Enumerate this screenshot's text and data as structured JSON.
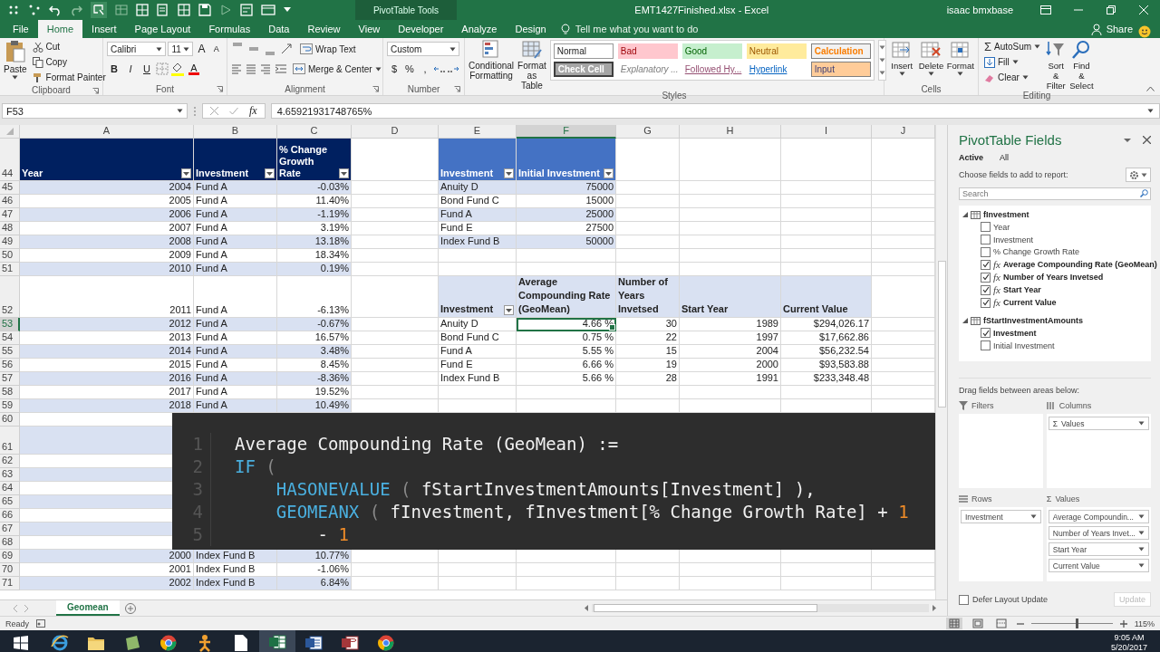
{
  "title_bar": {
    "context_tab_group": "PivotTable Tools",
    "title": "EMT1427Finished.xlsx  -  Excel",
    "user": "isaac bmxbase"
  },
  "ribbon_tabs": [
    {
      "label": "File",
      "selected": false
    },
    {
      "label": "Home",
      "selected": true
    },
    {
      "label": "Insert",
      "selected": false
    },
    {
      "label": "Page Layout",
      "selected": false
    },
    {
      "label": "Formulas",
      "selected": false
    },
    {
      "label": "Data",
      "selected": false
    },
    {
      "label": "Review",
      "selected": false
    },
    {
      "label": "View",
      "selected": false
    },
    {
      "label": "Developer",
      "selected": false
    },
    {
      "label": "Analyze",
      "selected": false
    },
    {
      "label": "Design",
      "selected": false
    }
  ],
  "tell_me": {
    "placeholder": "Tell me what you want to do"
  },
  "share": "Share",
  "ribbon_groups": [
    {
      "kind": "clipboard",
      "label": "Clipboard",
      "paste": "Paste",
      "commands": [
        {
          "kind": "cut",
          "label": "Cut"
        },
        {
          "kind": "copy",
          "label": "Copy"
        },
        {
          "kind": "painter",
          "label": "Format Painter"
        }
      ]
    },
    {
      "kind": "font",
      "label": "Font",
      "font_name": "Calibri",
      "font_size": "11",
      "size_symbols": [
        "A",
        "A"
      ],
      "style_symbols": [
        "B",
        "I",
        "U"
      ],
      "color_symbol": "A"
    },
    {
      "kind": "alignment",
      "label": "Alignment",
      "commands": [
        "Wrap Text",
        "Merge & Center"
      ]
    },
    {
      "kind": "number",
      "label": "Number",
      "format": "Custom",
      "symbols": [
        "$",
        "%",
        ","
      ]
    },
    {
      "kind": "styles",
      "label": "Styles",
      "commands": [
        "Conditional Formatting",
        "Format as Table"
      ],
      "gallery": [
        {
          "label": "Normal",
          "kind": "normal"
        },
        {
          "label": "Bad",
          "kind": "bad"
        },
        {
          "label": "Good",
          "kind": "good"
        },
        {
          "label": "Neutral",
          "kind": "neutral"
        },
        {
          "label": "Calculation",
          "kind": "calculation"
        },
        {
          "label": "Check Cell",
          "kind": "check"
        },
        {
          "label": "Explanatory ...",
          "kind": "explanatory"
        },
        {
          "label": "Followed Hy...",
          "kind": "followed"
        },
        {
          "label": "Hyperlink",
          "kind": "hyperlink"
        },
        {
          "label": "Input",
          "kind": "input"
        }
      ]
    },
    {
      "kind": "cells",
      "label": "Cells",
      "commands": [
        "Insert",
        "Delete",
        "Format"
      ]
    },
    {
      "kind": "editing",
      "label": "Editing",
      "autosum": {
        "symbol": "Σ",
        "label": "AutoSum"
      },
      "small_commands": [
        "Fill",
        "Clear"
      ],
      "commands": [
        "Sort & Filter",
        "Find & Select"
      ]
    }
  ],
  "formula_bar": {
    "name_box": "F53",
    "function_symbol": "fx",
    "value": "4.65921931748765%"
  },
  "sheet": {
    "columns": [
      {
        "label": "A",
        "selected": false
      },
      {
        "label": "B",
        "selected": false
      },
      {
        "label": "C",
        "selected": false
      },
      {
        "label": "D",
        "selected": false
      },
      {
        "label": "E",
        "selected": false
      },
      {
        "label": "F",
        "selected": true
      },
      {
        "label": "G",
        "selected": false
      },
      {
        "label": "H",
        "selected": false
      },
      {
        "label": "I",
        "selected": false
      },
      {
        "label": "J",
        "selected": false
      }
    ],
    "row_headers": [
      {
        "label": "44",
        "selected": false
      },
      {
        "label": "45",
        "selected": false
      },
      {
        "label": "46",
        "selected": false
      },
      {
        "label": "47",
        "selected": false
      },
      {
        "label": "48",
        "selected": false
      },
      {
        "label": "49",
        "selected": false
      },
      {
        "label": "50",
        "selected": false
      },
      {
        "label": "51",
        "selected": false
      },
      {
        "label": "52",
        "selected": false
      },
      {
        "label": "53",
        "selected": true
      },
      {
        "label": "54",
        "selected": false
      },
      {
        "label": "55",
        "selected": false
      },
      {
        "label": "56",
        "selected": false
      },
      {
        "label": "57",
        "selected": false
      },
      {
        "label": "58",
        "selected": false
      },
      {
        "label": "59",
        "selected": false
      },
      {
        "label": "60",
        "selected": false
      },
      {
        "label": "61",
        "selected": false
      },
      {
        "label": "62",
        "selected": false
      },
      {
        "label": "63",
        "selected": false
      },
      {
        "label": "64",
        "selected": false
      },
      {
        "label": "65",
        "selected": false
      },
      {
        "label": "66",
        "selected": false
      },
      {
        "label": "67",
        "selected": false
      },
      {
        "label": "68",
        "selected": false
      },
      {
        "label": "69",
        "selected": false
      },
      {
        "label": "70",
        "selected": false
      },
      {
        "label": "71",
        "selected": false
      }
    ],
    "growth_table": {
      "headers": [
        {
          "label": "Year",
          "filter": true
        },
        {
          "label": "Investment",
          "filter": true
        },
        {
          "label": "% Change Growth Rate",
          "filter": true
        }
      ],
      "rows": [
        {
          "year": "2004",
          "investment": "Fund A",
          "change": "-0.03%",
          "banded": true
        },
        {
          "year": "2005",
          "investment": "Fund A",
          "change": "11.40%",
          "banded": false
        },
        {
          "year": "2006",
          "investment": "Fund A",
          "change": "-1.19%",
          "banded": true
        },
        {
          "year": "2007",
          "investment": "Fund A",
          "change": "3.19%",
          "banded": false
        },
        {
          "year": "2008",
          "investment": "Fund A",
          "change": "13.18%",
          "banded": true
        },
        {
          "year": "2009",
          "investment": "Fund A",
          "change": "18.34%",
          "banded": false
        },
        {
          "year": "2010",
          "investment": "Fund A",
          "change": "0.19%",
          "banded": true
        },
        {
          "year": "2011",
          "investment": "Fund A",
          "change": "-6.13%",
          "banded": false
        },
        {
          "year": "2012",
          "investment": "Fund A",
          "change": "-0.67%",
          "banded": true
        },
        {
          "year": "2013",
          "investment": "Fund A",
          "change": "16.57%",
          "banded": false
        },
        {
          "year": "2014",
          "investment": "Fund A",
          "change": "3.48%",
          "banded": true
        },
        {
          "year": "2015",
          "investment": "Fund A",
          "change": "8.45%",
          "banded": false
        },
        {
          "year": "2016",
          "investment": "Fund A",
          "change": "-8.36%",
          "banded": true
        },
        {
          "year": "2017",
          "investment": "Fund A",
          "change": "19.52%",
          "banded": false
        },
        {
          "year": "2018",
          "investment": "Fund A",
          "change": "10.49%",
          "banded": true
        },
        {
          "banded": false
        },
        {
          "banded": true
        },
        {
          "banded": false
        },
        {
          "banded": true
        },
        {
          "banded": false
        },
        {
          "banded": true
        },
        {
          "banded": false
        },
        {
          "banded": true
        },
        {
          "banded": false
        },
        {
          "year": "2000",
          "investment": "Index Fund B",
          "change": "10.77%",
          "banded": true
        },
        {
          "year": "2001",
          "investment": "Index Fund B",
          "change": "-1.06%",
          "banded": false
        },
        {
          "year": "2002",
          "investment": "Index Fund B",
          "change": "6.84%",
          "banded": true
        }
      ]
    },
    "start_table": {
      "headers": [
        {
          "label": "Investment",
          "filter": true
        },
        {
          "label": "Initial Investment",
          "filter": true
        }
      ],
      "rows": [
        {
          "investment": "Anuity D",
          "amount": "75000",
          "banded": true
        },
        {
          "investment": "Bond Fund C",
          "amount": "15000",
          "banded": false
        },
        {
          "investment": "Fund A",
          "amount": "25000",
          "banded": true
        },
        {
          "investment": "Fund E",
          "amount": "27500",
          "banded": false
        },
        {
          "investment": "Index Fund B",
          "amount": "50000",
          "banded": true
        }
      ]
    },
    "pivot_table": {
      "headers": [
        {
          "label": "Investment",
          "filter": true
        },
        {
          "label": "Average Compounding Rate (GeoMean)"
        },
        {
          "label": "Number of Years Invetsed"
        },
        {
          "label": "Start Year"
        },
        {
          "label": "Current Value"
        }
      ],
      "rows": [
        {
          "investment": "Anuity D",
          "rate": "4.66 %",
          "years": "30",
          "start_year": "1989",
          "current_value": "$294,026.17"
        },
        {
          "investment": "Bond Fund C",
          "rate": "0.75 %",
          "years": "22",
          "start_year": "1997",
          "current_value": "$17,662.86"
        },
        {
          "investment": "Fund A",
          "rate": "5.55 %",
          "years": "15",
          "start_year": "2004",
          "current_value": "$56,232.54"
        },
        {
          "investment": "Fund E",
          "rate": "6.66 %",
          "years": "19",
          "start_year": "2000",
          "current_value": "$93,583.88"
        },
        {
          "investment": "Index Fund B",
          "rate": "5.66 %",
          "years": "28",
          "start_year": "1991",
          "current_value": "$233,348.48"
        }
      ]
    }
  },
  "code_overlay": {
    "lines": [
      {
        "number": "1",
        "tokens": [
          {
            "kind": "plain",
            "text": "Average Compounding Rate (GeoMean) :="
          }
        ]
      },
      {
        "number": "2",
        "tokens": [
          {
            "kind": "keyword",
            "text": "IF"
          },
          {
            "kind": "paren",
            "text": " ("
          }
        ]
      },
      {
        "number": "3",
        "tokens": [
          {
            "kind": "keyword",
            "text": "    HASONEVALUE"
          },
          {
            "kind": "paren",
            "text": " ( "
          },
          {
            "kind": "plain",
            "text": "fStartInvestmentAmounts[Investment] ),"
          }
        ]
      },
      {
        "number": "4",
        "tokens": [
          {
            "kind": "keyword",
            "text": "    GEOMEANX"
          },
          {
            "kind": "paren",
            "text": " ( "
          },
          {
            "kind": "plain",
            "text": "fInvestment, fInvestment[% Change Growth Rate] + "
          },
          {
            "kind": "number",
            "text": "1"
          }
        ]
      },
      {
        "number": "5",
        "tokens": [
          {
            "kind": "plain",
            "text": "        - "
          },
          {
            "kind": "number",
            "text": "1"
          }
        ]
      }
    ]
  },
  "sheet_tabs": [
    {
      "label": "Geomean",
      "selected": true
    }
  ],
  "pivot_fields": {
    "title": "PivotTable Fields",
    "view_tabs": [
      {
        "label": "Active",
        "selected": true
      },
      {
        "label": "All",
        "selected": false
      }
    ],
    "prompt": "Choose fields to add to report:",
    "search": {
      "placeholder": "Search"
    },
    "tables": [
      {
        "name": "fInvestment",
        "expanded": true,
        "children": [
          {
            "label": "Year",
            "checked": false,
            "kind": "column"
          },
          {
            "label": "Investment",
            "checked": false,
            "kind": "column"
          },
          {
            "label": "% Change Growth Rate",
            "checked": false,
            "kind": "column"
          },
          {
            "label": "Average Compounding Rate (GeoMean)",
            "checked": true,
            "kind": "measure",
            "symbol": "fx"
          },
          {
            "label": "Number of Years Invetsed",
            "checked": true,
            "kind": "measure",
            "symbol": "fx"
          },
          {
            "label": "Start Year",
            "checked": true,
            "kind": "measure",
            "symbol": "fx"
          },
          {
            "label": "Current Value",
            "checked": true,
            "kind": "measure",
            "symbol": "fx"
          }
        ]
      },
      {
        "name": "fStartInvestmentAmounts",
        "expanded": true,
        "children": [
          {
            "label": "Investment",
            "checked": true,
            "kind": "column"
          },
          {
            "label": "Initial Investment",
            "checked": false,
            "kind": "column"
          }
        ]
      }
    ],
    "drag_hint": "Drag fields between areas below:",
    "areas": [
      {
        "kind": "filters",
        "label": "Filters"
      },
      {
        "kind": "columns",
        "label": "Columns",
        "items": [
          {
            "label": "Values",
            "symbol": "Σ"
          }
        ]
      },
      {
        "kind": "rows",
        "label": "Rows",
        "items": [
          {
            "label": "Investment"
          }
        ]
      },
      {
        "kind": "values",
        "label": "Values",
        "symbol": "Σ",
        "items": [
          {
            "label": "Average Compoundin..."
          },
          {
            "label": "Number of Years Invet..."
          },
          {
            "label": "Start Year"
          },
          {
            "label": "Current Value"
          }
        ]
      }
    ],
    "defer_update": {
      "label": "Defer Layout Update",
      "checked": false
    },
    "update_button": {
      "label": "Update",
      "disabled": true
    }
  },
  "status_bar": {
    "status": "Ready",
    "zoom": "115%",
    "zoom_slider": {
      "level": 0.55
    },
    "views": [
      {
        "kind": "normal",
        "selected": true
      },
      {
        "kind": "page_layout",
        "selected": false
      },
      {
        "kind": "page_break",
        "selected": false
      }
    ]
  },
  "taskbar": {
    "apps": [
      {
        "kind": "browser_e",
        "selected": false
      },
      {
        "kind": "folder",
        "selected": false
      },
      {
        "kind": "green_tile",
        "selected": false
      },
      {
        "kind": "round_browser",
        "selected": false
      },
      {
        "kind": "figure",
        "selected": false
      },
      {
        "kind": "document",
        "selected": false
      },
      {
        "kind": "spreadsheet",
        "selected": true
      },
      {
        "kind": "word_processor",
        "selected": false
      },
      {
        "kind": "database",
        "selected": false
      },
      {
        "kind": "round_browser",
        "selected": false
      }
    ],
    "time": "9:05 AM",
    "date": "5/20/2017"
  }
}
